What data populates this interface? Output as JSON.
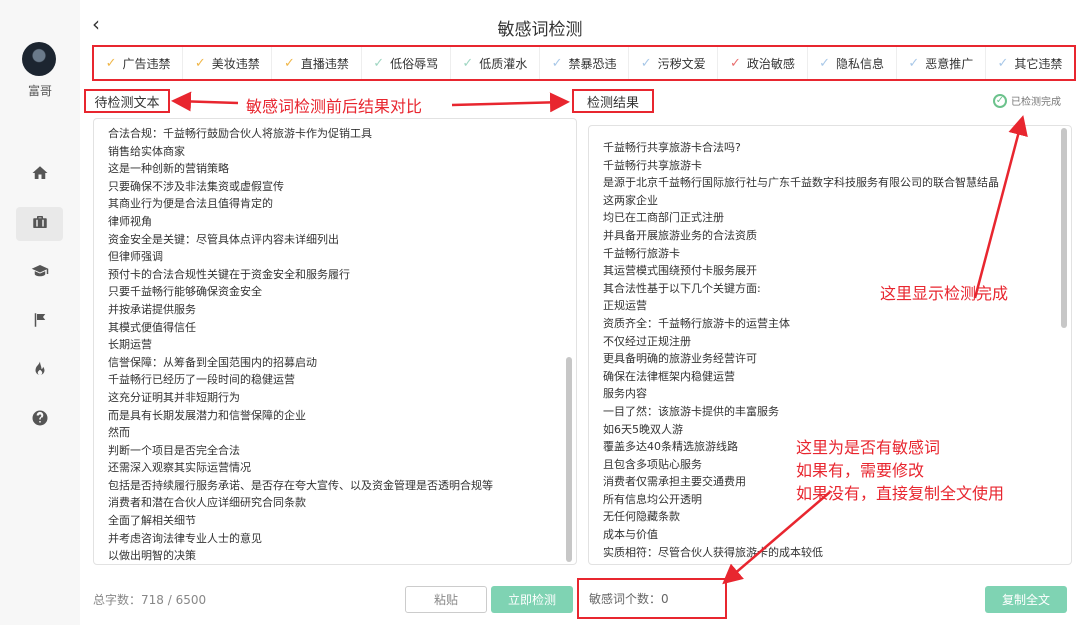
{
  "sidebar": {
    "username": "富哥",
    "nav": [
      {
        "icon": "home-icon",
        "active": false
      },
      {
        "icon": "briefcase-icon",
        "active": true
      },
      {
        "icon": "graduation-cap-icon",
        "active": false
      },
      {
        "icon": "flag-icon",
        "active": false
      },
      {
        "icon": "fire-icon",
        "active": false
      },
      {
        "icon": "help-icon",
        "active": false
      }
    ]
  },
  "header": {
    "back_icon": "chevron-left-icon",
    "title": "敏感词检测"
  },
  "categories": [
    {
      "label": "广告违禁",
      "check_color": "#f0b74a"
    },
    {
      "label": "美妆违禁",
      "check_color": "#f0b74a"
    },
    {
      "label": "直播违禁",
      "check_color": "#f0b74a"
    },
    {
      "label": "低俗辱骂",
      "check_color": "#9fd6c2"
    },
    {
      "label": "低质灌水",
      "check_color": "#9fd6c2"
    },
    {
      "label": "禁暴恐违",
      "check_color": "#a9c8e8"
    },
    {
      "label": "污秽文爱",
      "check_color": "#a9c8e8"
    },
    {
      "label": "政治敏感",
      "check_color": "#e87070"
    },
    {
      "label": "隐私信息",
      "check_color": "#a9c8e8"
    },
    {
      "label": "恶意推广",
      "check_color": "#a9c8e8"
    },
    {
      "label": "其它违禁",
      "check_color": "#a9c8e8"
    }
  ],
  "labels": {
    "input_label": "待检测文本",
    "result_label": "检测结果",
    "status_done": "已检测完成"
  },
  "input_text": [
    "合法合规：千益畅行鼓励合伙人将旅游卡作为促销工具",
    "销售给实体商家",
    "这是一种创新的营销策略",
    "只要确保不涉及非法集资或虚假宣传",
    "其商业行为便是合法且值得肯定的",
    "律师视角",
    "资金安全是关键：尽管具体点评内容未详细列出",
    "但律师强调",
    "预付卡的合法合规性关键在于资金安全和服务履行",
    "只要千益畅行能够确保资金安全",
    "并按承诺提供服务",
    "其模式便值得信任",
    "长期运营",
    "信誉保障：从筹备到全国范围内的招募启动",
    "千益畅行已经历了一段时间的稳健运营",
    "这充分证明其并非短期行为",
    "而是具有长期发展潜力和信誉保障的企业",
    "然而",
    "判断一个项目是否完全合法",
    "还需深入观察其实际运营情况",
    "包括是否持续履行服务承诺、是否存在夸大宣传、以及资金管理是否透明合规等",
    "消费者和潜在合伙人应详细研究合同条款",
    "全面了解相关细节",
    "并考虑咨询法律专业人士的意见",
    "以做出明智的决策"
  ],
  "result_text": [
    "千益畅行共享旅游卡合法吗?",
    "千益畅行共享旅游卡",
    "是源于北京千益畅行国际旅行社与广东千益数字科技服务有限公司的联合智慧结晶",
    "这两家企业",
    "均已在工商部门正式注册",
    "并具备开展旅游业务的合法资质",
    "千益畅行旅游卡",
    "其运营模式围绕预付卡服务展开",
    "其合法性基于以下几个关键方面:",
    "正规运营",
    "资质齐全：千益畅行旅游卡的运营主体",
    "不仅经过正规注册",
    "更具备明确的旅游业务经营许可",
    "确保在法律框架内稳健运营",
    "服务内容",
    "一目了然：该旅游卡提供的丰富服务",
    "如6天5晚双人游",
    "覆盖多达40条精选旅游线路",
    "且包含多项贴心服务",
    "消费者仅需承担主要交通费用",
    "所有信息均公开透明",
    "无任何隐藏条款",
    "成本与价值",
    "实质相符：尽管合伙人获得旅游卡的成本较低"
  ],
  "annotations": {
    "compare": "敏感词检测前后结果对比",
    "done": "这里显示检测完成",
    "note_lines": [
      "这里为是否有敏感词",
      "如果有，需要修改",
      "如果没有，直接复制全文使用"
    ]
  },
  "footer": {
    "char_count": "总字数：718 / 6500",
    "paste_button": "粘贴",
    "detect_button": "立即检测",
    "sensitive_count": "敏感词个数：0",
    "copy_button": "复制全文"
  },
  "colors": {
    "accent": "#7fd3b3",
    "annotation_red": "#e8262f",
    "done_green": "#6cc28c"
  }
}
